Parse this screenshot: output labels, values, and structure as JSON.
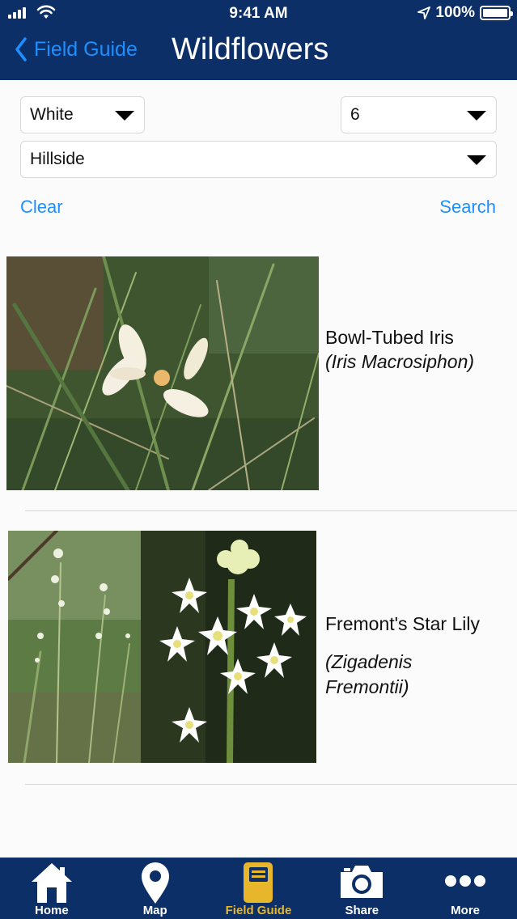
{
  "status_bar": {
    "time": "9:41 AM",
    "battery": "100%"
  },
  "nav": {
    "back_label": "Field Guide",
    "title": "Wildflowers"
  },
  "filters": {
    "color": {
      "selected": "White"
    },
    "petals": {
      "selected": "6"
    },
    "habitat": {
      "selected": "Hillside"
    },
    "clear_label": "Clear",
    "search_label": "Search"
  },
  "results": [
    {
      "common_name": "Bowl-Tubed Iris",
      "latin_name": "(Iris Macrosiphon)"
    },
    {
      "common_name": "Fremont's Star Lily",
      "latin_name": "(Zigadenis Fremontii)"
    }
  ],
  "tabbar": {
    "items": [
      {
        "label": "Home",
        "icon": "home-icon"
      },
      {
        "label": "Map",
        "icon": "map-pin-icon"
      },
      {
        "label": "Field Guide",
        "icon": "book-icon",
        "active": true
      },
      {
        "label": "Share",
        "icon": "camera-icon"
      },
      {
        "label": "More",
        "icon": "more-icon"
      }
    ],
    "active_color": "#e8b62a"
  },
  "colors": {
    "header": "#0b2f66",
    "link": "#1e8fff"
  }
}
